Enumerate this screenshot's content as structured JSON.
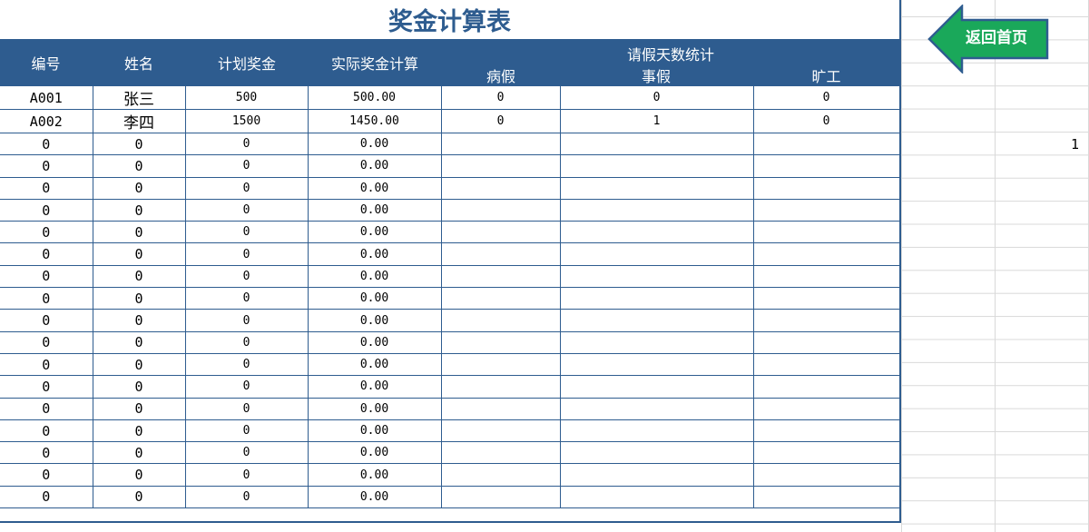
{
  "sheet": {
    "title": "奖金计算表",
    "headers": {
      "id": "编号",
      "name": "姓名",
      "planned_bonus": "计划奖金",
      "actual_bonus": "实际奖金计算",
      "leave_stats": "请假天数统计",
      "sick_leave": "病假",
      "personal_leave": "事假",
      "absence": "旷工"
    },
    "rows": [
      [
        "A001",
        "张三",
        "500",
        "500.00",
        "0",
        "0",
        "0"
      ],
      [
        "A002",
        "李四",
        "1500",
        "1450.00",
        "0",
        "1",
        "0"
      ],
      [
        "0",
        "0",
        "0",
        "0.00",
        "",
        "",
        ""
      ],
      [
        "0",
        "0",
        "0",
        "0.00",
        "",
        "",
        ""
      ],
      [
        "0",
        "0",
        "0",
        "0.00",
        "",
        "",
        ""
      ],
      [
        "0",
        "0",
        "0",
        "0.00",
        "",
        "",
        ""
      ],
      [
        "0",
        "0",
        "0",
        "0.00",
        "",
        "",
        ""
      ],
      [
        "0",
        "0",
        "0",
        "0.00",
        "",
        "",
        ""
      ],
      [
        "0",
        "0",
        "0",
        "0.00",
        "",
        "",
        ""
      ],
      [
        "0",
        "0",
        "0",
        "0.00",
        "",
        "",
        ""
      ],
      [
        "0",
        "0",
        "0",
        "0.00",
        "",
        "",
        ""
      ],
      [
        "0",
        "0",
        "0",
        "0.00",
        "",
        "",
        ""
      ],
      [
        "0",
        "0",
        "0",
        "0.00",
        "",
        "",
        ""
      ],
      [
        "0",
        "0",
        "0",
        "0.00",
        "",
        "",
        ""
      ],
      [
        "0",
        "0",
        "0",
        "0.00",
        "",
        "",
        ""
      ],
      [
        "0",
        "0",
        "0",
        "0.00",
        "",
        "",
        ""
      ],
      [
        "0",
        "0",
        "0",
        "0.00",
        "",
        "",
        ""
      ],
      [
        "0",
        "0",
        "0",
        "0.00",
        "",
        "",
        ""
      ],
      [
        "0",
        "0",
        "0",
        "0.00",
        "",
        "",
        ""
      ]
    ]
  },
  "side_cell_value": "1",
  "back_button": {
    "label": "返回首页",
    "icon": "left-arrow-icon",
    "color": "#1aa85a",
    "border_color": "#2e5c8f"
  },
  "colors": {
    "header_bg": "#2e5c8f",
    "title_text": "#2e5c8f"
  }
}
